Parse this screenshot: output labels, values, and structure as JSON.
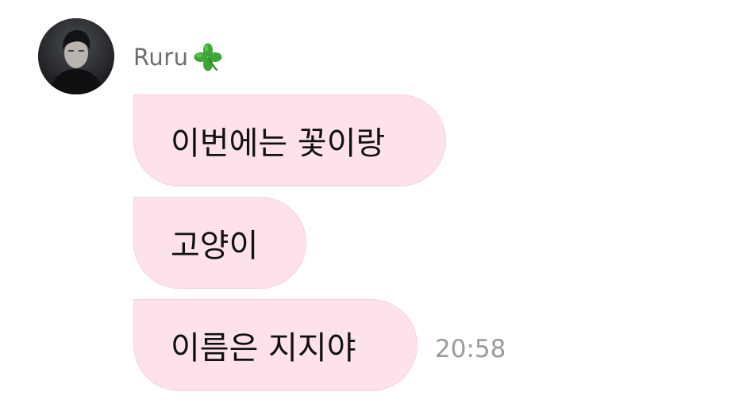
{
  "sender": {
    "name": "Ruru",
    "emoji_icon": "four-leaf-clover-icon"
  },
  "messages": [
    {
      "text": "이번에는 꽃이랑"
    },
    {
      "text": "고양이"
    },
    {
      "text": "이름은 지지야"
    }
  ],
  "timestamp": "20:58",
  "colors": {
    "bubble_background": "#fde3e9",
    "sender_name": "#6e6e6e",
    "timestamp": "#9b9b9b",
    "clover": "#3fa535"
  }
}
